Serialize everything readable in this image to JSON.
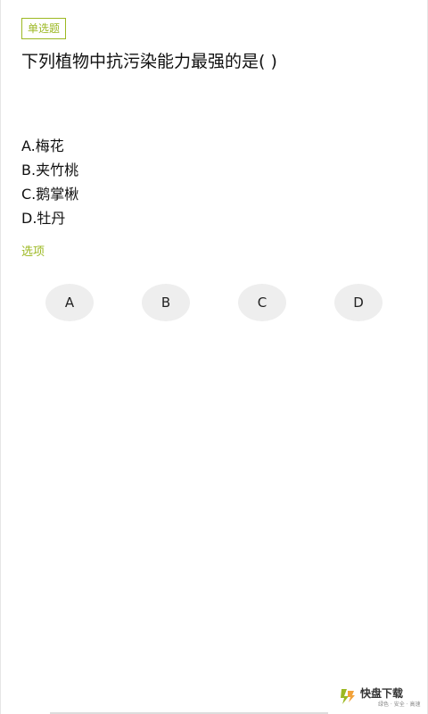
{
  "question": {
    "type_tag": "单选题",
    "text": "下列植物中抗污染能力最强的是( )",
    "options": [
      {
        "label": "A.梅花"
      },
      {
        "label": "B.夹竹桃"
      },
      {
        "label": "C.鹅掌楸"
      },
      {
        "label": "D.牡丹"
      }
    ]
  },
  "answer_section": {
    "title": "选项",
    "buttons": [
      "A",
      "B",
      "C",
      "D"
    ]
  },
  "watermark": {
    "icon": "download-logo-icon",
    "brand": "快盘下载",
    "tagline": "绿色 · 安全 · 高速"
  },
  "colors": {
    "accent": "#9cb822",
    "button_bg": "#eeeeee",
    "text": "#111111"
  }
}
